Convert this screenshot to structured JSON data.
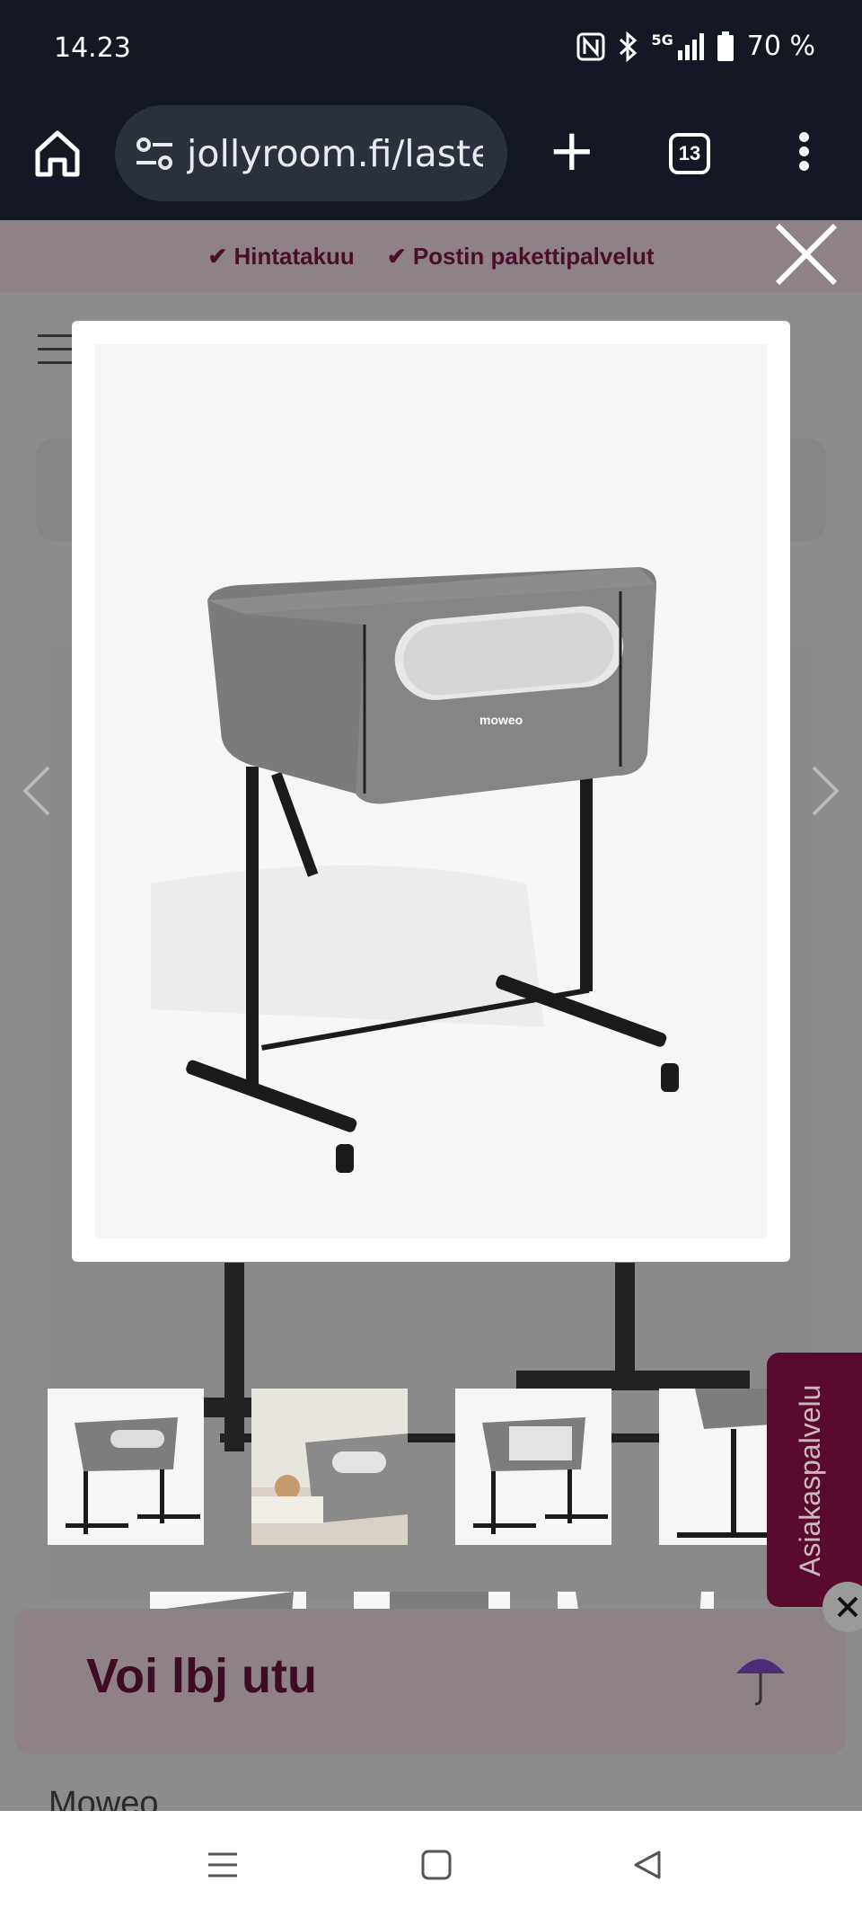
{
  "status": {
    "time": "14.23",
    "network": "5G",
    "battery": "70 %"
  },
  "browser": {
    "url": "jollyroom.fi/laster",
    "tab_count": "13"
  },
  "promo": {
    "items": [
      "✔ Hintatakuu",
      "✔ Postin pakettipalvelut"
    ]
  },
  "banner": {
    "text": "Voi     lbj     utu"
  },
  "side_tab": {
    "label": "Asiakaspalvelu"
  },
  "page": {
    "brand": "Moweo"
  },
  "product": {
    "logo": "moweo"
  }
}
